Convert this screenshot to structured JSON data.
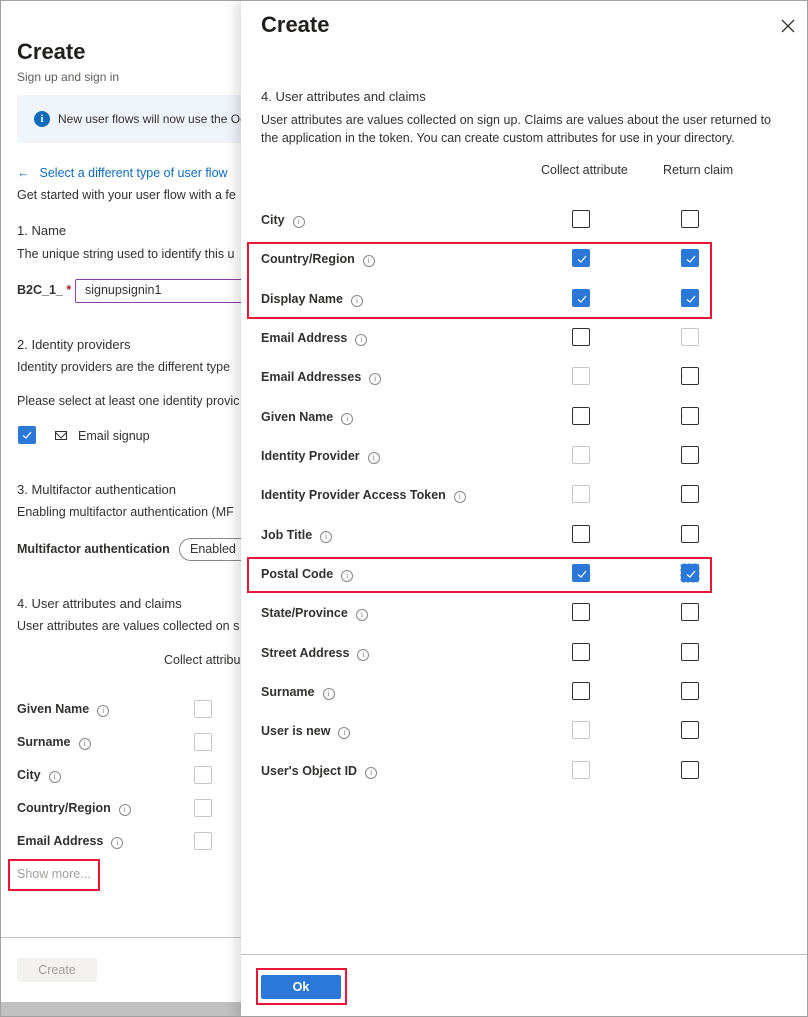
{
  "background_blade": {
    "title": "Create",
    "subtitle": "Sign up and sign in",
    "banner_text": "New user flows will now use the Oc",
    "back_link": "Select a different type of user flow",
    "intro": "Get started with your user flow with a fe",
    "name_section": {
      "title": "1. Name",
      "description": "The unique string used to identify this u",
      "prefix": "B2C_1_",
      "required_marker": "*",
      "value": "signupsignin1"
    },
    "identity_section": {
      "title": "2. Identity providers",
      "description": "Identity providers are the different type",
      "instruction": "Please select at least one identity provic",
      "email_signup_label": "Email signup",
      "email_signup_checked": true
    },
    "mfa_section": {
      "title": "3. Multifactor authentication",
      "description": "Enabling multifactor authentication (MF",
      "label": "Multifactor authentication",
      "selected": "Enabled"
    },
    "attributes_section": {
      "title": "4. User attributes and claims",
      "description": "User attributes are values collected on s",
      "column_header": "Collect attribu",
      "rows": [
        {
          "label": "Given Name",
          "checked": false
        },
        {
          "label": "Surname",
          "checked": false
        },
        {
          "label": "City",
          "checked": false
        },
        {
          "label": "Country/Region",
          "checked": false
        },
        {
          "label": "Email Address",
          "checked": false
        }
      ],
      "show_more": "Show more..."
    },
    "create_button": "Create"
  },
  "dialog": {
    "title": "Create",
    "section_title": "4. User attributes and claims",
    "section_description": "User attributes are values collected on sign up. Claims are values about the user returned to the application in the token. You can create custom attributes for use in your directory.",
    "columns": {
      "collect": "Collect attribute",
      "return": "Return claim"
    },
    "rows": [
      {
        "label": "City",
        "collect": "unchecked",
        "return": "unchecked"
      },
      {
        "label": "Country/Region",
        "collect": "checked",
        "return": "checked"
      },
      {
        "label": "Display Name",
        "collect": "checked",
        "return": "checked"
      },
      {
        "label": "Email Address",
        "collect": "unchecked",
        "return": "disabled"
      },
      {
        "label": "Email Addresses",
        "collect": "disabled",
        "return": "unchecked"
      },
      {
        "label": "Given Name",
        "collect": "unchecked",
        "return": "unchecked"
      },
      {
        "label": "Identity Provider",
        "collect": "disabled",
        "return": "unchecked"
      },
      {
        "label": "Identity Provider Access Token",
        "collect": "disabled",
        "return": "unchecked"
      },
      {
        "label": "Job Title",
        "collect": "unchecked",
        "return": "unchecked"
      },
      {
        "label": "Postal Code",
        "collect": "checked",
        "return": "checked-focused"
      },
      {
        "label": "State/Province",
        "collect": "unchecked",
        "return": "unchecked"
      },
      {
        "label": "Street Address",
        "collect": "unchecked",
        "return": "unchecked"
      },
      {
        "label": "Surname",
        "collect": "unchecked",
        "return": "unchecked"
      },
      {
        "label": "User is new",
        "collect": "disabled",
        "return": "unchecked"
      },
      {
        "label": "User's Object ID",
        "collect": "disabled",
        "return": "unchecked"
      }
    ],
    "ok_button": "Ok"
  },
  "colors": {
    "accent": "#2b78d8",
    "highlight": "#e8173a",
    "link": "#0f6cbd"
  }
}
